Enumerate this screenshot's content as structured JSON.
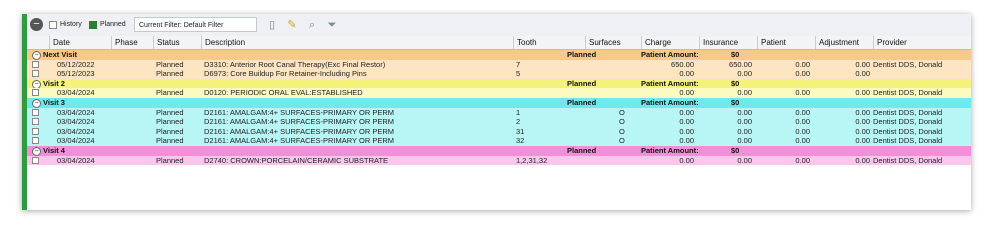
{
  "toolbar": {
    "history_label": "History",
    "planned_label": "Planned",
    "filter_text": "Current Filter: Default Filter",
    "icons": [
      "save-icon",
      "edit-icon",
      "search-icon",
      "filter-icon"
    ]
  },
  "columns": {
    "date": "Date",
    "phase": "Phase",
    "status": "Status",
    "description": "Description",
    "tooth": "Tooth",
    "surfaces": "Surfaces",
    "charge": "Charge",
    "insurance": "Insurance",
    "patient": "Patient",
    "adjustment": "Adjustment",
    "provider": "Provider"
  },
  "colors": {
    "visit_next": "#f9c98b",
    "visit_next_row": "#fde4c3",
    "visit_2": "#f4f27a",
    "visit_2_row": "#fbfac0",
    "visit_3": "#6eeaea",
    "visit_3_row": "#b8f6f6",
    "visit_4": "#f58ed8",
    "visit_4_row": "#fbc6ec",
    "accent": "#2e9b3e"
  },
  "groups": [
    {
      "title": "Next Visit",
      "status": "Planned",
      "amount_label": "Patient Amount:",
      "amount": "$0",
      "rows": [
        {
          "date": "05/12/2022",
          "status": "Planned",
          "description": "D3310: Anterior Root Canal Therapy(Exc Final Restor)",
          "tooth": "7",
          "surfaces": "",
          "charge": "650.00",
          "insurance": "650.00",
          "patient": "0.00",
          "adjustment": "0.00",
          "provider": "Dentist DDS, Donald"
        },
        {
          "date": "05/12/2023",
          "status": "Planned",
          "description": "D6973: Core Buildup For Retainer-Including Pins",
          "tooth": "5",
          "surfaces": "",
          "charge": "0.00",
          "insurance": "0.00",
          "patient": "0.00",
          "adjustment": "0.00",
          "provider": ""
        }
      ]
    },
    {
      "title": "Visit 2",
      "status": "Planned",
      "amount_label": "Patient Amount:",
      "amount": "$0",
      "rows": [
        {
          "date": "03/04/2024",
          "status": "Planned",
          "description": "D0120: PERIODIC ORAL EVAL:ESTABLISHED",
          "tooth": "",
          "surfaces": "",
          "charge": "0.00",
          "insurance": "0.00",
          "patient": "0.00",
          "adjustment": "0.00",
          "provider": "Dentist DDS, Donald"
        }
      ]
    },
    {
      "title": "Visit 3",
      "status": "Planned",
      "amount_label": "Patient Amount:",
      "amount": "$0",
      "rows": [
        {
          "date": "03/04/2024",
          "status": "Planned",
          "description": "D2161: AMALGAM:4+ SURFACES-PRIMARY OR PERM",
          "tooth": "1",
          "surfaces": "O",
          "charge": "0.00",
          "insurance": "0.00",
          "patient": "0.00",
          "adjustment": "0.00",
          "provider": "Dentist DDS, Donald"
        },
        {
          "date": "03/04/2024",
          "status": "Planned",
          "description": "D2161: AMALGAM:4+ SURFACES-PRIMARY OR PERM",
          "tooth": "2",
          "surfaces": "O",
          "charge": "0.00",
          "insurance": "0.00",
          "patient": "0.00",
          "adjustment": "0.00",
          "provider": "Dentist DDS, Donald"
        },
        {
          "date": "03/04/2024",
          "status": "Planned",
          "description": "D2161: AMALGAM:4+ SURFACES-PRIMARY OR PERM",
          "tooth": "31",
          "surfaces": "O",
          "charge": "0.00",
          "insurance": "0.00",
          "patient": "0.00",
          "adjustment": "0.00",
          "provider": "Dentist DDS, Donald"
        },
        {
          "date": "03/04/2024",
          "status": "Planned",
          "description": "D2161: AMALGAM:4+ SURFACES-PRIMARY OR PERM",
          "tooth": "32",
          "surfaces": "O",
          "charge": "0.00",
          "insurance": "0.00",
          "patient": "0.00",
          "adjustment": "0.00",
          "provider": "Dentist DDS, Donald"
        }
      ]
    },
    {
      "title": "Visit 4",
      "status": "Planned",
      "amount_label": "Patient Amount:",
      "amount": "$0",
      "rows": [
        {
          "date": "03/04/2024",
          "status": "Planned",
          "description": "D2740: CROWN:PORCELAIN/CERAMIC SUBSTRATE",
          "tooth": "1,2,31,32",
          "surfaces": "",
          "charge": "0.00",
          "insurance": "0.00",
          "patient": "0.00",
          "adjustment": "0.00",
          "provider": "Dentist DDS, Donald"
        }
      ]
    }
  ]
}
